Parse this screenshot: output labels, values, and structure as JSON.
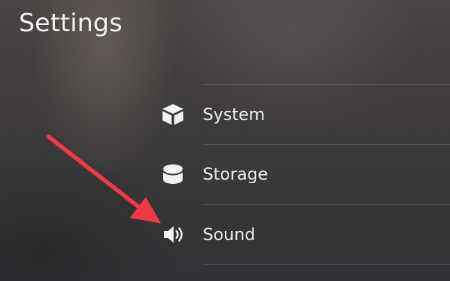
{
  "page": {
    "title": "Settings"
  },
  "settings_menu": {
    "items": [
      {
        "label": "System",
        "icon": "cube-icon"
      },
      {
        "label": "Storage",
        "icon": "database-cylinder-icon"
      },
      {
        "label": "Sound",
        "icon": "speaker-icon"
      }
    ]
  },
  "annotation": {
    "arrow_color": "#ef3a45",
    "arrow_icon": "red-arrow-pointer"
  },
  "colors": {
    "text": "#ececec",
    "background": "#3d3a3a",
    "divider": "rgba(255,255,255,0.16)"
  }
}
